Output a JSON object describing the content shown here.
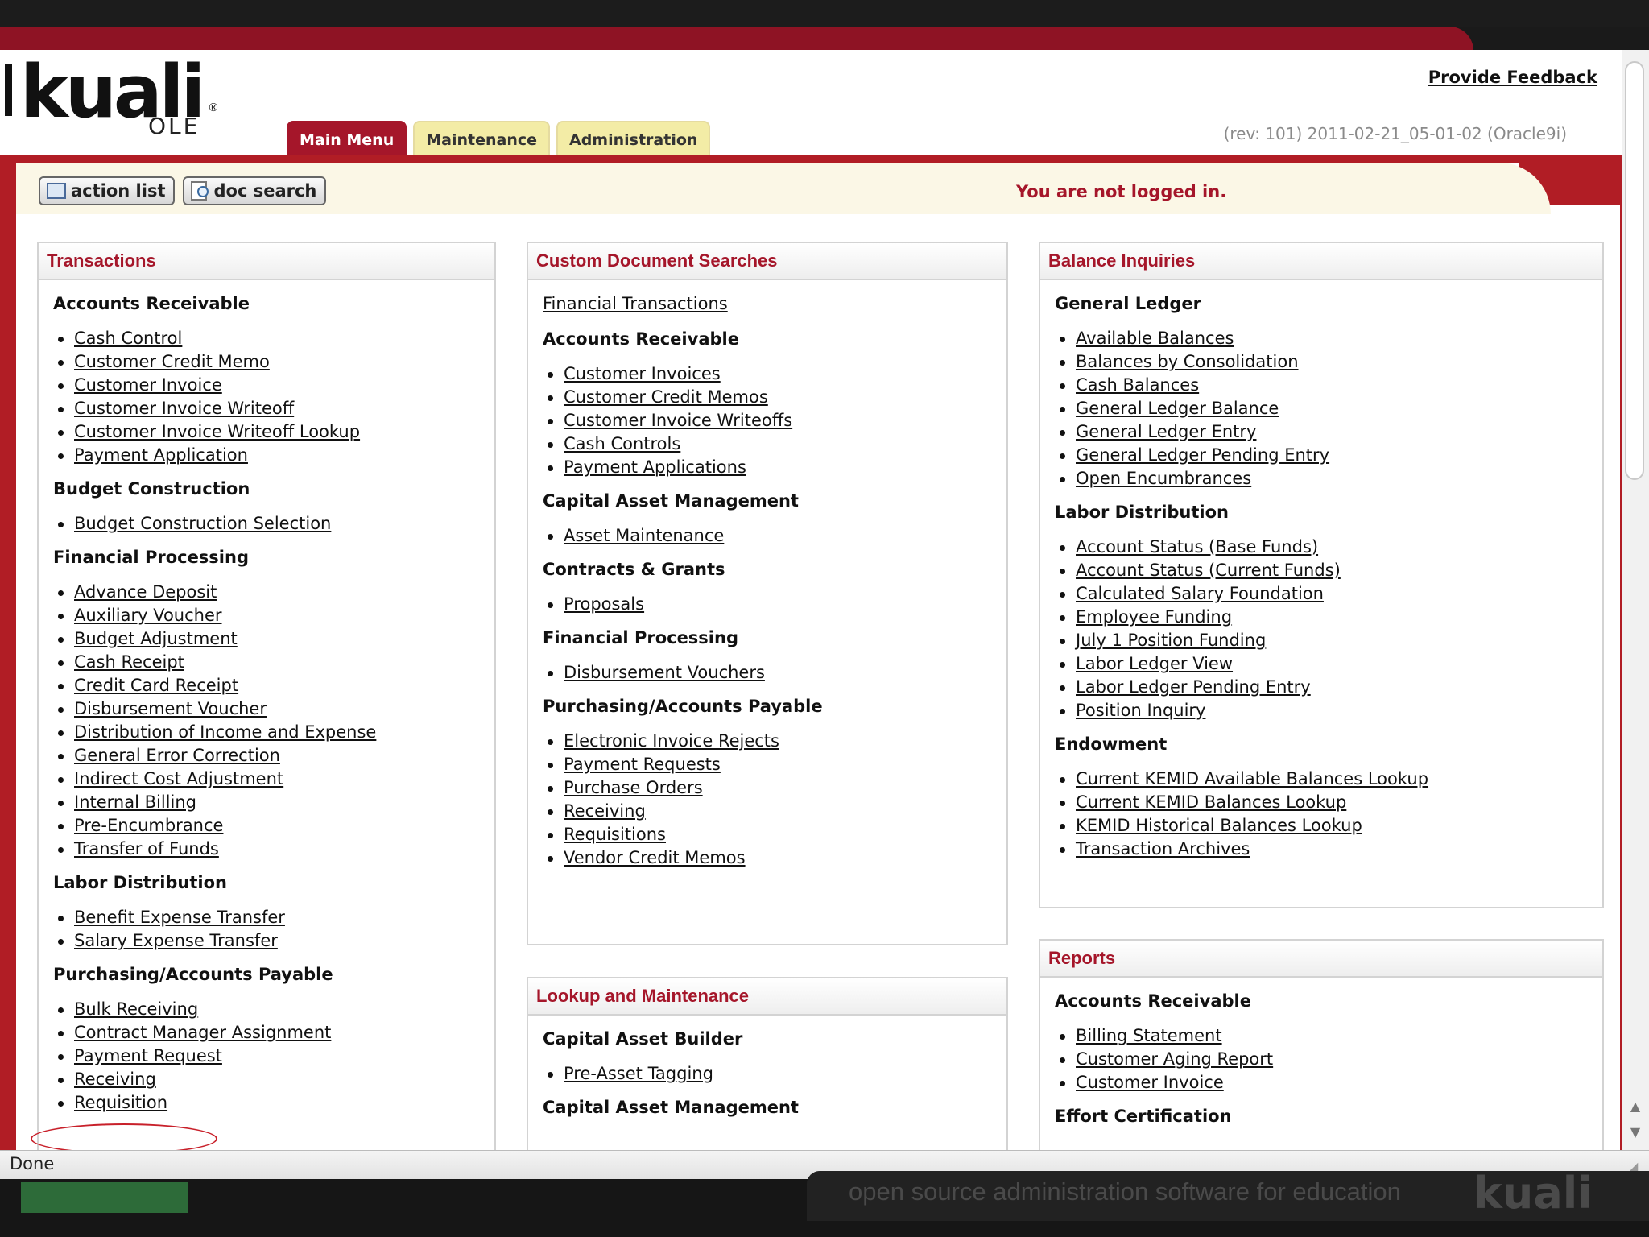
{
  "header": {
    "logo_text": "kuali",
    "logo_sub": "OLE",
    "feedback": "Provide Feedback",
    "revision": "(rev: 101) 2011-02-21_05-01-02 (Oracle9i)"
  },
  "tabs": [
    {
      "label": "Main Menu",
      "active": true
    },
    {
      "label": "Maintenance",
      "active": false
    },
    {
      "label": "Administration",
      "active": false
    }
  ],
  "toolbar": {
    "action_list": "action list",
    "doc_search": "doc search",
    "status_message": "You are not logged in."
  },
  "transactions": {
    "title": "Transactions",
    "sections": [
      {
        "heading": "Accounts Receivable",
        "links": [
          "Cash Control",
          "Customer Credit Memo",
          "Customer Invoice",
          "Customer Invoice Writeoff",
          "Customer Invoice Writeoff Lookup",
          "Payment Application"
        ]
      },
      {
        "heading": "Budget Construction",
        "links": [
          "Budget Construction Selection"
        ]
      },
      {
        "heading": "Financial Processing",
        "links": [
          "Advance Deposit",
          "Auxiliary Voucher",
          "Budget Adjustment",
          "Cash Receipt",
          "Credit Card Receipt",
          "Disbursement Voucher",
          "Distribution of Income and Expense",
          "General Error Correction",
          "Indirect Cost Adjustment",
          "Internal Billing",
          "Pre-Encumbrance",
          "Transfer of Funds"
        ]
      },
      {
        "heading": "Labor Distribution",
        "links": [
          "Benefit Expense Transfer",
          "Salary Expense Transfer"
        ]
      },
      {
        "heading": "Purchasing/Accounts Payable",
        "links": [
          "Bulk Receiving",
          "Contract Manager Assignment",
          "Payment Request",
          "Receiving",
          "Requisition"
        ]
      }
    ]
  },
  "custom_searches": {
    "title": "Custom Document Searches",
    "top_link": "Financial Transactions",
    "sections": [
      {
        "heading": "Accounts Receivable",
        "links": [
          "Customer Invoices",
          "Customer Credit Memos",
          "Customer Invoice Writeoffs",
          "Cash Controls",
          "Payment Applications"
        ]
      },
      {
        "heading": "Capital Asset Management",
        "links": [
          "Asset Maintenance"
        ]
      },
      {
        "heading": "Contracts & Grants",
        "links": [
          "Proposals"
        ]
      },
      {
        "heading": "Financial Processing",
        "links": [
          "Disbursement Vouchers"
        ]
      },
      {
        "heading": "Purchasing/Accounts Payable",
        "links": [
          "Electronic Invoice Rejects",
          "Payment Requests",
          "Purchase Orders",
          "Receiving",
          "Requisitions",
          "Vendor Credit Memos"
        ]
      }
    ]
  },
  "lookup": {
    "title": "Lookup and Maintenance",
    "sections": [
      {
        "heading": "Capital Asset Builder",
        "links": [
          "Pre-Asset Tagging"
        ]
      },
      {
        "heading": "Capital Asset Management",
        "links": []
      }
    ]
  },
  "balance": {
    "title": "Balance Inquiries",
    "sections": [
      {
        "heading": "General Ledger",
        "links": [
          "Available Balances",
          "Balances by Consolidation",
          "Cash Balances",
          "General Ledger Balance",
          "General Ledger Entry",
          "General Ledger Pending Entry",
          "Open Encumbrances"
        ]
      },
      {
        "heading": "Labor Distribution",
        "links": [
          "Account Status (Base Funds)",
          "Account Status (Current Funds)",
          "Calculated Salary Foundation",
          "Employee Funding",
          "July 1 Position Funding",
          "Labor Ledger View",
          "Labor Ledger Pending Entry",
          "Position Inquiry"
        ]
      },
      {
        "heading": "Endowment",
        "links": [
          "Current KEMID Available Balances Lookup",
          "Current KEMID Balances Lookup",
          "KEMID Historical Balances Lookup",
          "Transaction Archives"
        ]
      }
    ]
  },
  "reports": {
    "title": "Reports",
    "sections": [
      {
        "heading": "Accounts Receivable",
        "links": [
          "Billing Statement",
          "Customer Aging Report",
          "Customer Invoice"
        ]
      },
      {
        "heading": "Effort Certification",
        "links": []
      }
    ]
  },
  "status_bar": {
    "text": "Done"
  },
  "footer": {
    "tagline": "open source administration software for education",
    "logo": "kuali"
  },
  "colors": {
    "brand_red": "#a5162a",
    "frame_red": "#b11d25",
    "tab_inactive": "#f3eca6",
    "cream": "#fbf7e6"
  }
}
